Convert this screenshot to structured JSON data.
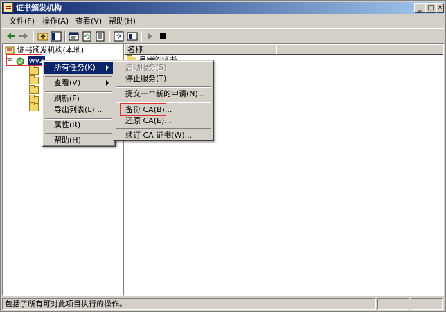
{
  "window": {
    "title": "证书颁发机构"
  },
  "menubar": {
    "items": [
      {
        "label": "文件(F)"
      },
      {
        "label": "操作(A)"
      },
      {
        "label": "查看(V)"
      },
      {
        "label": "帮助(H)"
      }
    ]
  },
  "toolbar": {
    "icons": [
      "back-arrow-icon",
      "forward-arrow-icon",
      "up-folder-icon",
      "show-hide-tree-icon",
      "properties-icon",
      "refresh-icon",
      "export-list-icon",
      "help-icon",
      "details-icon",
      "start-icon",
      "stop-icon"
    ]
  },
  "tree": {
    "root": "证书颁发机构(本地)",
    "ca_node": "wyz",
    "child_visible_prefix": "证"
  },
  "list": {
    "column_name": "名称",
    "first_item": "吊销的证书"
  },
  "context_menu": {
    "items": [
      {
        "label": "所有任务(K)"
      },
      {
        "label": "查看(V)"
      },
      {
        "label": "刷新(F)"
      },
      {
        "label": "导出列表(L)..."
      },
      {
        "label": "属性(R)"
      },
      {
        "label": "帮助(H)"
      }
    ]
  },
  "submenu": {
    "items": [
      {
        "label": "启动服务(S)",
        "disabled": true
      },
      {
        "label": "停止服务(T)"
      },
      {
        "label": "提交一个新的申请(N)..."
      },
      {
        "label": "备份 CA(B)..."
      },
      {
        "label": "还原 CA(E)..."
      },
      {
        "label": "续订 CA 证书(W)..."
      }
    ]
  },
  "statusbar": {
    "text": "包括了所有可对此项目执行的操作。"
  },
  "colors": {
    "titlebar": "#0a246a",
    "highlight": "#0a246a",
    "annotation": "#e03030",
    "face": "#d4d0c8"
  }
}
